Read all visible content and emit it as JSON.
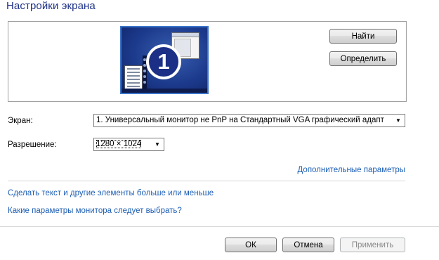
{
  "title": "Настройки экрана",
  "preview": {
    "monitor_number": "1"
  },
  "buttons": {
    "find": "Найти",
    "identify": "Определить",
    "ok": "ОК",
    "cancel": "Отмена",
    "apply": "Применить"
  },
  "display": {
    "label": "Экран:",
    "value": "1. Универсальный монитор не PnP на Стандартный VGA графический адапт"
  },
  "resolution": {
    "label": "Разрешение:",
    "value": "1280 × 1024"
  },
  "links": {
    "advanced": "Дополнительные параметры",
    "text_size": "Сделать текст и другие элементы больше или меньше",
    "which_settings": "Какие параметры монитора следует выбрать?"
  },
  "colors": {
    "title": "#1e3287",
    "link": "#1e5fb4",
    "monitor_frame": "#3b74c8"
  }
}
